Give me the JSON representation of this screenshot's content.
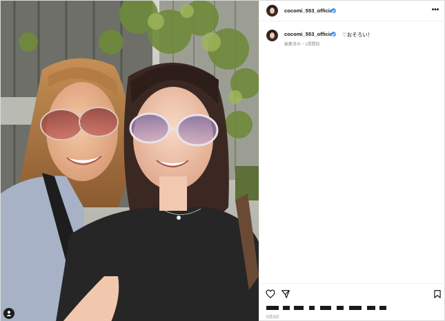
{
  "post": {
    "username": "cocomi_553_official",
    "caption": "♡おそろい！",
    "meta": "編集済み・1週間前",
    "date": "5月3日"
  },
  "icons": {
    "more": "more-options-icon",
    "like": "heart-icon",
    "share": "paper-plane-icon",
    "save": "bookmark-icon",
    "tagged": "user-icon",
    "verified": "verified-badge-icon"
  },
  "colors": {
    "verified": "#3897f0",
    "border": "#efefef",
    "meta_text": "#8e8e8e"
  }
}
